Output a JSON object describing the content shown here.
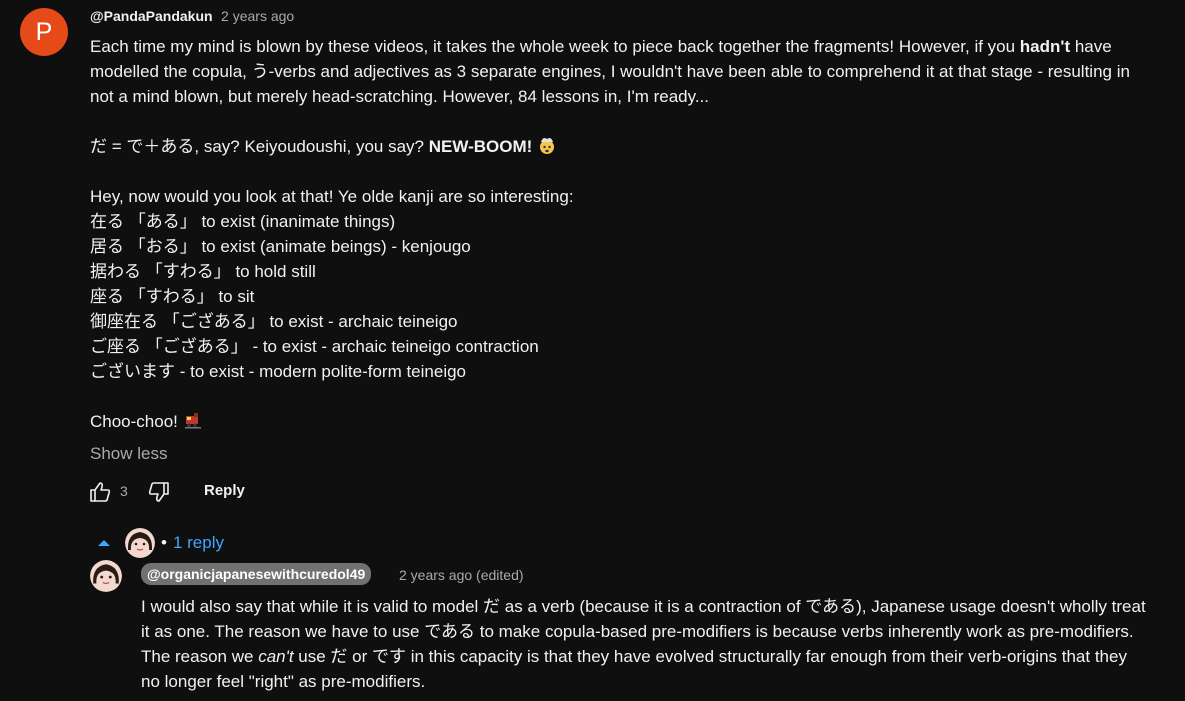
{
  "comment": {
    "avatar_letter": "P",
    "author": "@PandaPandakun",
    "time": "2 years ago",
    "p1_lines": [
      [
        "Each time my mind is blown by these videos, it takes the whole week to piece back together the fragments! However, if you ",
        "hadn't",
        " have"
      ],
      [
        "modelled the copula, う-verbs and adjectives as 3 separate engines, I wouldn't have been able to comprehend it at that stage - resulting in",
        "",
        ""
      ],
      [
        "not a mind blown, but merely head-scratching. However, 84 lessons in, I'm ready...",
        "",
        ""
      ]
    ],
    "p2_pre": "だ = で＋ある, say? Keiyoudoushi, you say? ",
    "p2_bold": "NEW-BOOM!",
    "kanji_lines": [
      "Hey, now would you look at that! Ye olde kanji are so interesting:",
      "在る 「ある」 to exist (inanimate things)",
      "居る 「おる」 to exist (animate beings) - kenjougo",
      "据わる 「すわる」 to hold still",
      "座る 「すわる」 to sit",
      "御座在る 「ござある」 to exist - archaic teineigo",
      "ご座る 「ござある」 - to exist - archaic teineigo contraction",
      "ございます - to exist - modern polite-form teineigo"
    ],
    "closing": "Choo-choo!",
    "show_less": "Show less",
    "likes": "3",
    "reply_label": "Reply",
    "replies_label": "1 reply"
  },
  "reply": {
    "author": "@organicjapanesewithcuredol49",
    "time": "2 years ago (edited)",
    "lines": [
      [
        "I would also say that while it is valid to model だ as a verb (because it is a contraction of である), Japanese usage doesn't wholly treat",
        "",
        ""
      ],
      [
        "it as one. The reason we have to use である to make copula-based pre-modifiers is because verbs inherently work as pre-modifiers.",
        "",
        ""
      ],
      [
        "The reason we ",
        "can't",
        " use だ or です in this capacity is that they have evolved structurally far enough from their verb-origins that they"
      ],
      [
        "no longer feel \"right\" as pre-modifiers.",
        "",
        ""
      ]
    ]
  },
  "colors": {
    "accent": "#3ea6ff",
    "avatar_bg": "#e64a19"
  },
  "icons": [
    "thumb-up-icon",
    "thumb-down-icon",
    "caret-up-icon",
    "exploding-head-emoji",
    "train-emoji"
  ]
}
